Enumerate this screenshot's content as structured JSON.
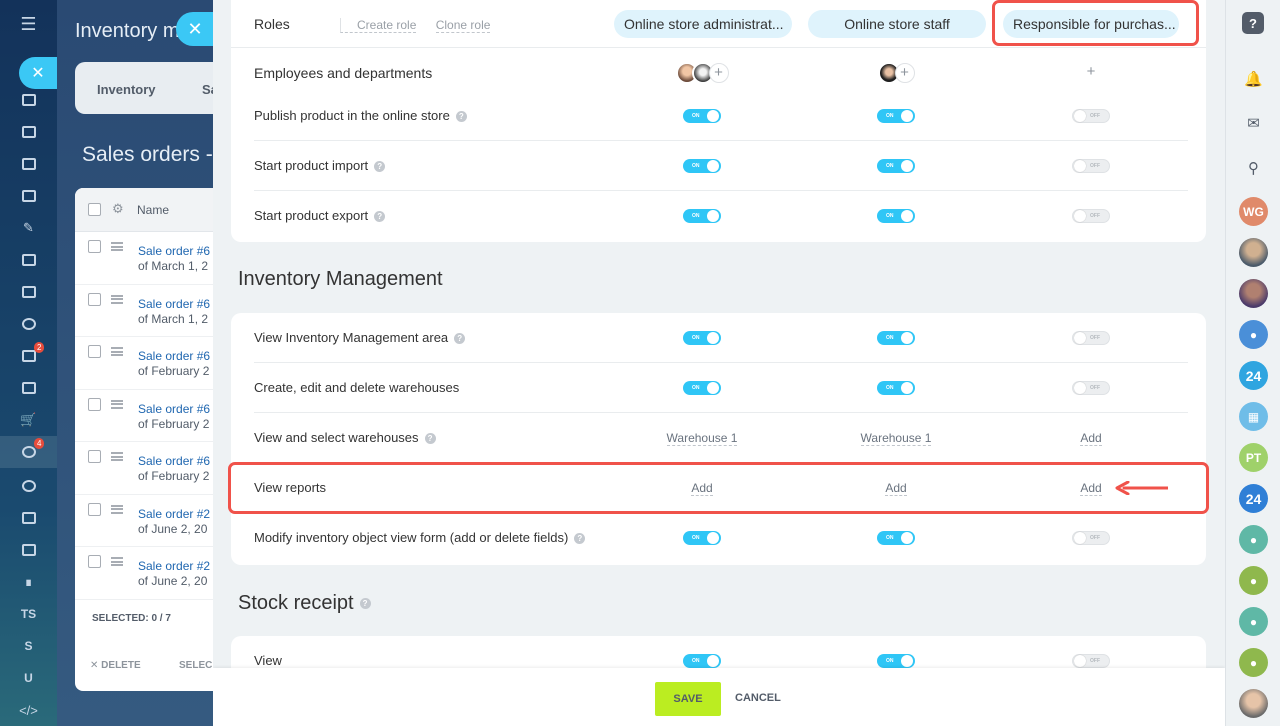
{
  "left_sidebar": {
    "menu_icon": "hamburger-icon",
    "badges": {
      "mail": "2",
      "filter": "4"
    },
    "text_items": [
      "TS",
      "S",
      "U"
    ]
  },
  "background_page": {
    "title": "Inventory m",
    "tabs": [
      "Inventory",
      "Sa"
    ],
    "subtitle": "Sales orders -",
    "list_header": "Name",
    "rows": [
      {
        "title": "Sale order #6",
        "date": "of March 1, 2"
      },
      {
        "title": "Sale order #6",
        "date": "of March 1, 2"
      },
      {
        "title": "Sale order #6",
        "date": "of February 2"
      },
      {
        "title": "Sale order #6",
        "date": "of February 2"
      },
      {
        "title": "Sale order #6",
        "date": "of February 2"
      },
      {
        "title": "Sale order #2",
        "date": "of June 2, 20"
      },
      {
        "title": "Sale order #2",
        "date": "of June 2, 20"
      }
    ],
    "selected": "SELECTED: 0 / 7",
    "delete": "DELETE",
    "select": "SELEC"
  },
  "roles": {
    "label": "Roles",
    "create_role": "Create role",
    "clone_role": "Clone role",
    "columns": [
      "Online store administrat...",
      "Online store staff",
      "Responsible for purchas..."
    ],
    "employees_label": "Employees and departments"
  },
  "toggle_labels": {
    "on": "ON",
    "off": "OFF"
  },
  "store_rows": [
    {
      "label": "Publish product in the online store",
      "help": true,
      "values": [
        "on",
        "on",
        "off"
      ]
    },
    {
      "label": "Start product import",
      "help": true,
      "values": [
        "on",
        "on",
        "off"
      ]
    },
    {
      "label": "Start product export",
      "help": true,
      "values": [
        "on",
        "on",
        "off"
      ]
    }
  ],
  "inventory": {
    "title": "Inventory Management",
    "rows": [
      {
        "label": "View Inventory Management area",
        "help": true,
        "values": [
          "on",
          "on",
          "off"
        ]
      },
      {
        "label": "Create, edit and delete warehouses",
        "help": false,
        "values": [
          "on",
          "on",
          "off"
        ]
      },
      {
        "label": "View and select warehouses",
        "help": true,
        "values": [
          "Warehouse 1",
          "Warehouse 1",
          "Add"
        ]
      },
      {
        "label": "View reports",
        "help": false,
        "values": [
          "Add",
          "Add",
          "Add"
        ]
      },
      {
        "label": "Modify inventory object view form (add or delete fields)",
        "help": true,
        "values": [
          "on",
          "on",
          "off"
        ]
      }
    ]
  },
  "stock_receipt": {
    "title": "Stock receipt",
    "rows": [
      {
        "label": "View",
        "help": false,
        "values": [
          "on",
          "on",
          "off"
        ]
      }
    ]
  },
  "footer": {
    "save": "SAVE",
    "cancel": "CANCEL"
  },
  "right_sidebar": {
    "help": "?",
    "avatars": [
      "WG",
      "PT"
    ],
    "bitrix_badge": "24"
  },
  "colors": {
    "accent": "#2fc6f6",
    "save": "#bbed21",
    "highlight": "#f0524a"
  }
}
